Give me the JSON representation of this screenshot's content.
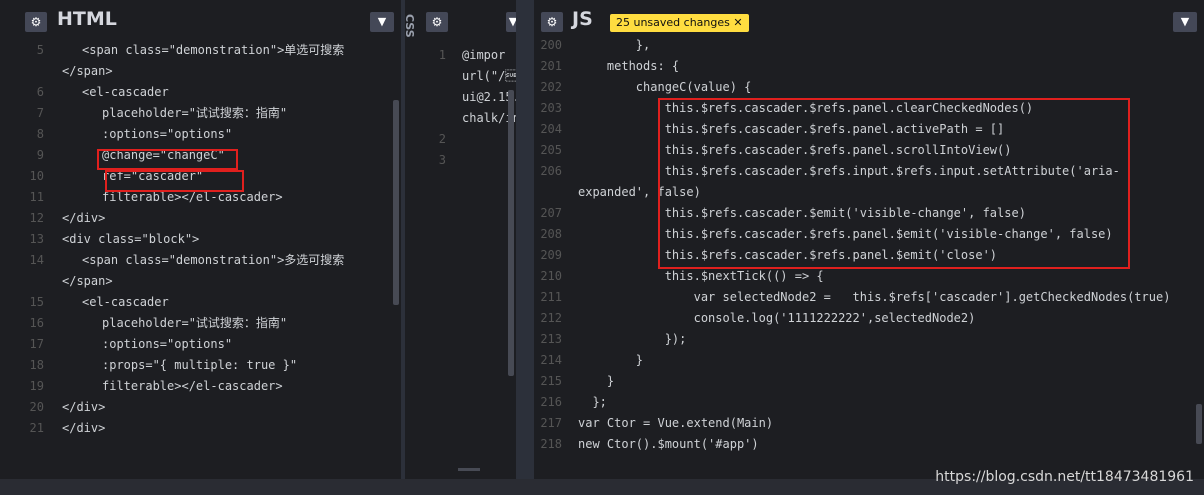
{
  "html_panel": {
    "title": "HTML",
    "lines": [
      {
        "n": "5",
        "text": "<span class=\"demonstration\">单选可搜索"
      },
      {
        "n": "",
        "text": "</span>"
      },
      {
        "n": "6",
        "text": "<el-cascader"
      },
      {
        "n": "7",
        "text": "placeholder=\"试试搜索：指南\""
      },
      {
        "n": "8",
        "text": ":options=\"options\""
      },
      {
        "n": "9",
        "text": "@change=\"changeC\""
      },
      {
        "n": "10",
        "text": "ref=\"cascader\""
      },
      {
        "n": "11",
        "text": "filterable></el-cascader>"
      },
      {
        "n": "12",
        "text": "</div>"
      },
      {
        "n": "13",
        "text": "<div class=\"block\">"
      },
      {
        "n": "14",
        "text": "<span class=\"demonstration\">多选可搜索"
      },
      {
        "n": "",
        "text": "</span>"
      },
      {
        "n": "15",
        "text": "<el-cascader"
      },
      {
        "n": "16",
        "text": "placeholder=\"试试搜索：指南\""
      },
      {
        "n": "17",
        "text": ":options=\"options\""
      },
      {
        "n": "18",
        "text": ":props=\"{ multiple: true }\""
      },
      {
        "n": "19",
        "text": "filterable></el-cascader>"
      },
      {
        "n": "20",
        "text": "</div>"
      },
      {
        "n": "21",
        "text": "</div>"
      }
    ]
  },
  "css_panel": {
    "title": "CSS",
    "lines": [
      {
        "n": "1",
        "text": "@impor"
      },
      {
        "n": "",
        "text": "url(\"/\u001a"
      },
      {
        "n": "",
        "text": "ui@2.15."
      },
      {
        "n": "",
        "text": "chalk/in"
      },
      {
        "n": "2",
        "text": ""
      },
      {
        "n": "3",
        "text": ""
      }
    ]
  },
  "js_panel": {
    "title": "JS",
    "badge": "25 unsaved changes ✕",
    "lines": [
      {
        "n": "200",
        "text": "        },"
      },
      {
        "n": "201",
        "text": "    methods: {"
      },
      {
        "n": "202",
        "text": "        changeC(value) {"
      },
      {
        "n": "203",
        "text": "            this.$refs.cascader.$refs.panel.clearCheckedNodes()"
      },
      {
        "n": "204",
        "text": "            this.$refs.cascader.$refs.panel.activePath = []"
      },
      {
        "n": "205",
        "text": "            this.$refs.cascader.$refs.panel.scrollIntoView()"
      },
      {
        "n": "206",
        "text": "            this.$refs.cascader.$refs.input.$refs.input.setAttribute('aria-"
      },
      {
        "n": "",
        "text": "expanded', false)"
      },
      {
        "n": "207",
        "text": "            this.$refs.cascader.$emit('visible-change', false)"
      },
      {
        "n": "208",
        "text": "            this.$refs.cascader.$refs.panel.$emit('visible-change', false)"
      },
      {
        "n": "209",
        "text": "            this.$refs.cascader.$refs.panel.$emit('close')"
      },
      {
        "n": "210",
        "text": "            this.$nextTick(() => {"
      },
      {
        "n": "211",
        "text": "                var selectedNode2 =   this.$refs['cascader'].getCheckedNodes(true)"
      },
      {
        "n": "212",
        "text": "                console.log('1111222222',selectedNode2)"
      },
      {
        "n": "213",
        "text": "            });"
      },
      {
        "n": "214",
        "text": "        }"
      },
      {
        "n": "215",
        "text": "    }"
      },
      {
        "n": "216",
        "text": "  };"
      },
      {
        "n": "217",
        "text": "var Ctor = Vue.extend(Main)"
      },
      {
        "n": "218",
        "text": "new Ctor().$mount('#app')"
      }
    ]
  },
  "watermark": "https://blog.csdn.net/tt18473481961",
  "colors": {
    "accent": "#ffdd40",
    "highlight": "#e0201e",
    "bg": "#1d1e22"
  }
}
